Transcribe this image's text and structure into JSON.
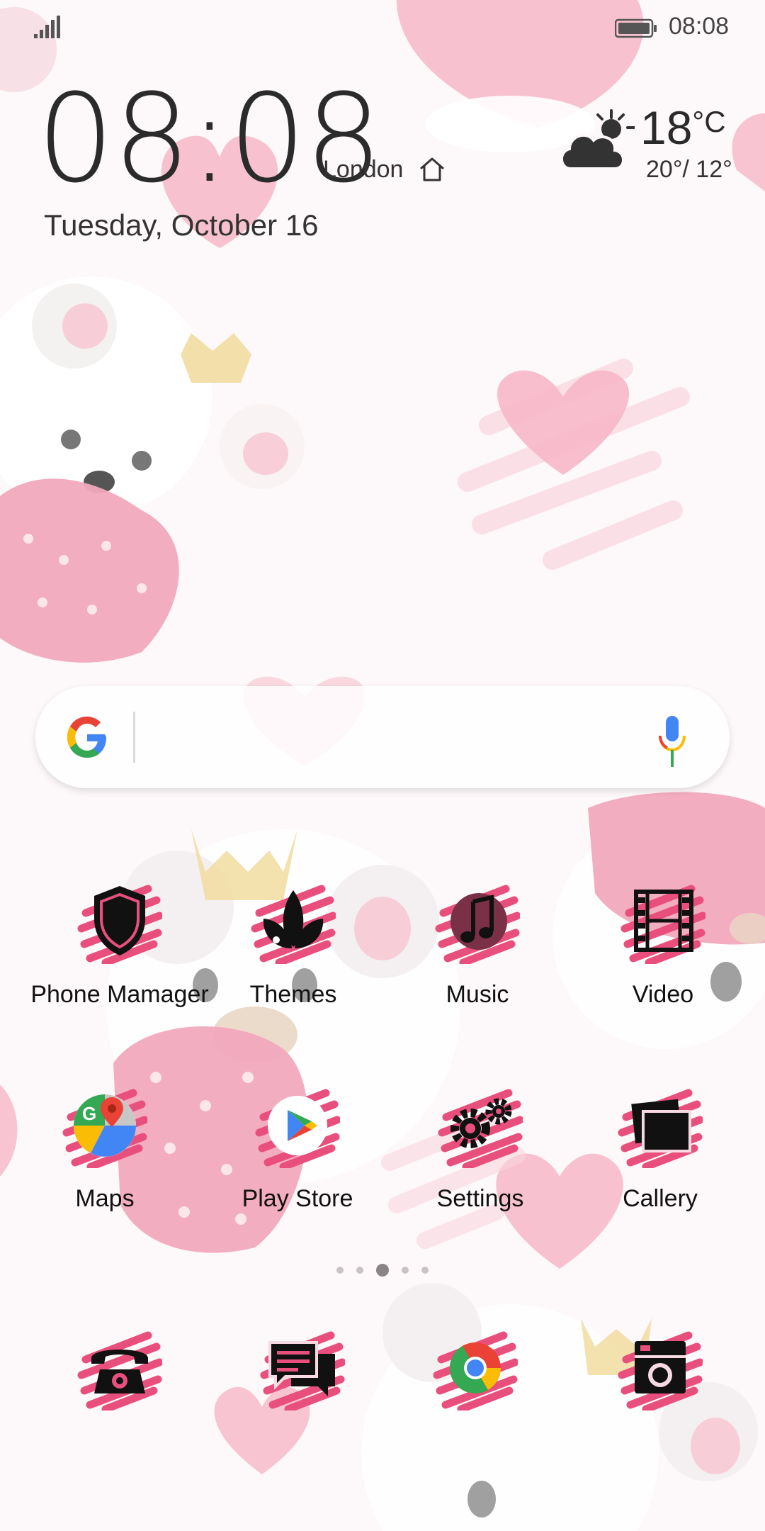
{
  "status_bar": {
    "time": "08:08"
  },
  "clock_widget": {
    "time": "08:08",
    "city": "London",
    "date": "Tuesday, October 16",
    "temperature": "18",
    "temperature_unit": "°C",
    "high_low": "20°/ 12°"
  },
  "search_bar": {
    "logo": "google-logo",
    "mic": "mic-icon"
  },
  "apps_row1": [
    {
      "label": "Phone Mamager",
      "icon": "shield-icon"
    },
    {
      "label": "Themes",
      "icon": "leaf-icon"
    },
    {
      "label": "Music",
      "icon": "music-note-icon"
    },
    {
      "label": "Video",
      "icon": "film-icon"
    }
  ],
  "apps_row2": [
    {
      "label": "Maps",
      "icon": "maps-icon"
    },
    {
      "label": "Play Store",
      "icon": "play-store-icon"
    },
    {
      "label": "Settings",
      "icon": "gears-icon"
    },
    {
      "label": "Callery",
      "icon": "gallery-icon"
    }
  ],
  "page_indicator": {
    "pages": 5,
    "current": 3
  },
  "dock": [
    {
      "icon": "phone-icon"
    },
    {
      "icon": "messages-icon"
    },
    {
      "icon": "chrome-icon"
    },
    {
      "icon": "camera-icon"
    }
  ],
  "colors": {
    "accent_pink": "#e94f7d",
    "heart_pink": "#f7b7c8",
    "background": "#fdf8f9"
  }
}
